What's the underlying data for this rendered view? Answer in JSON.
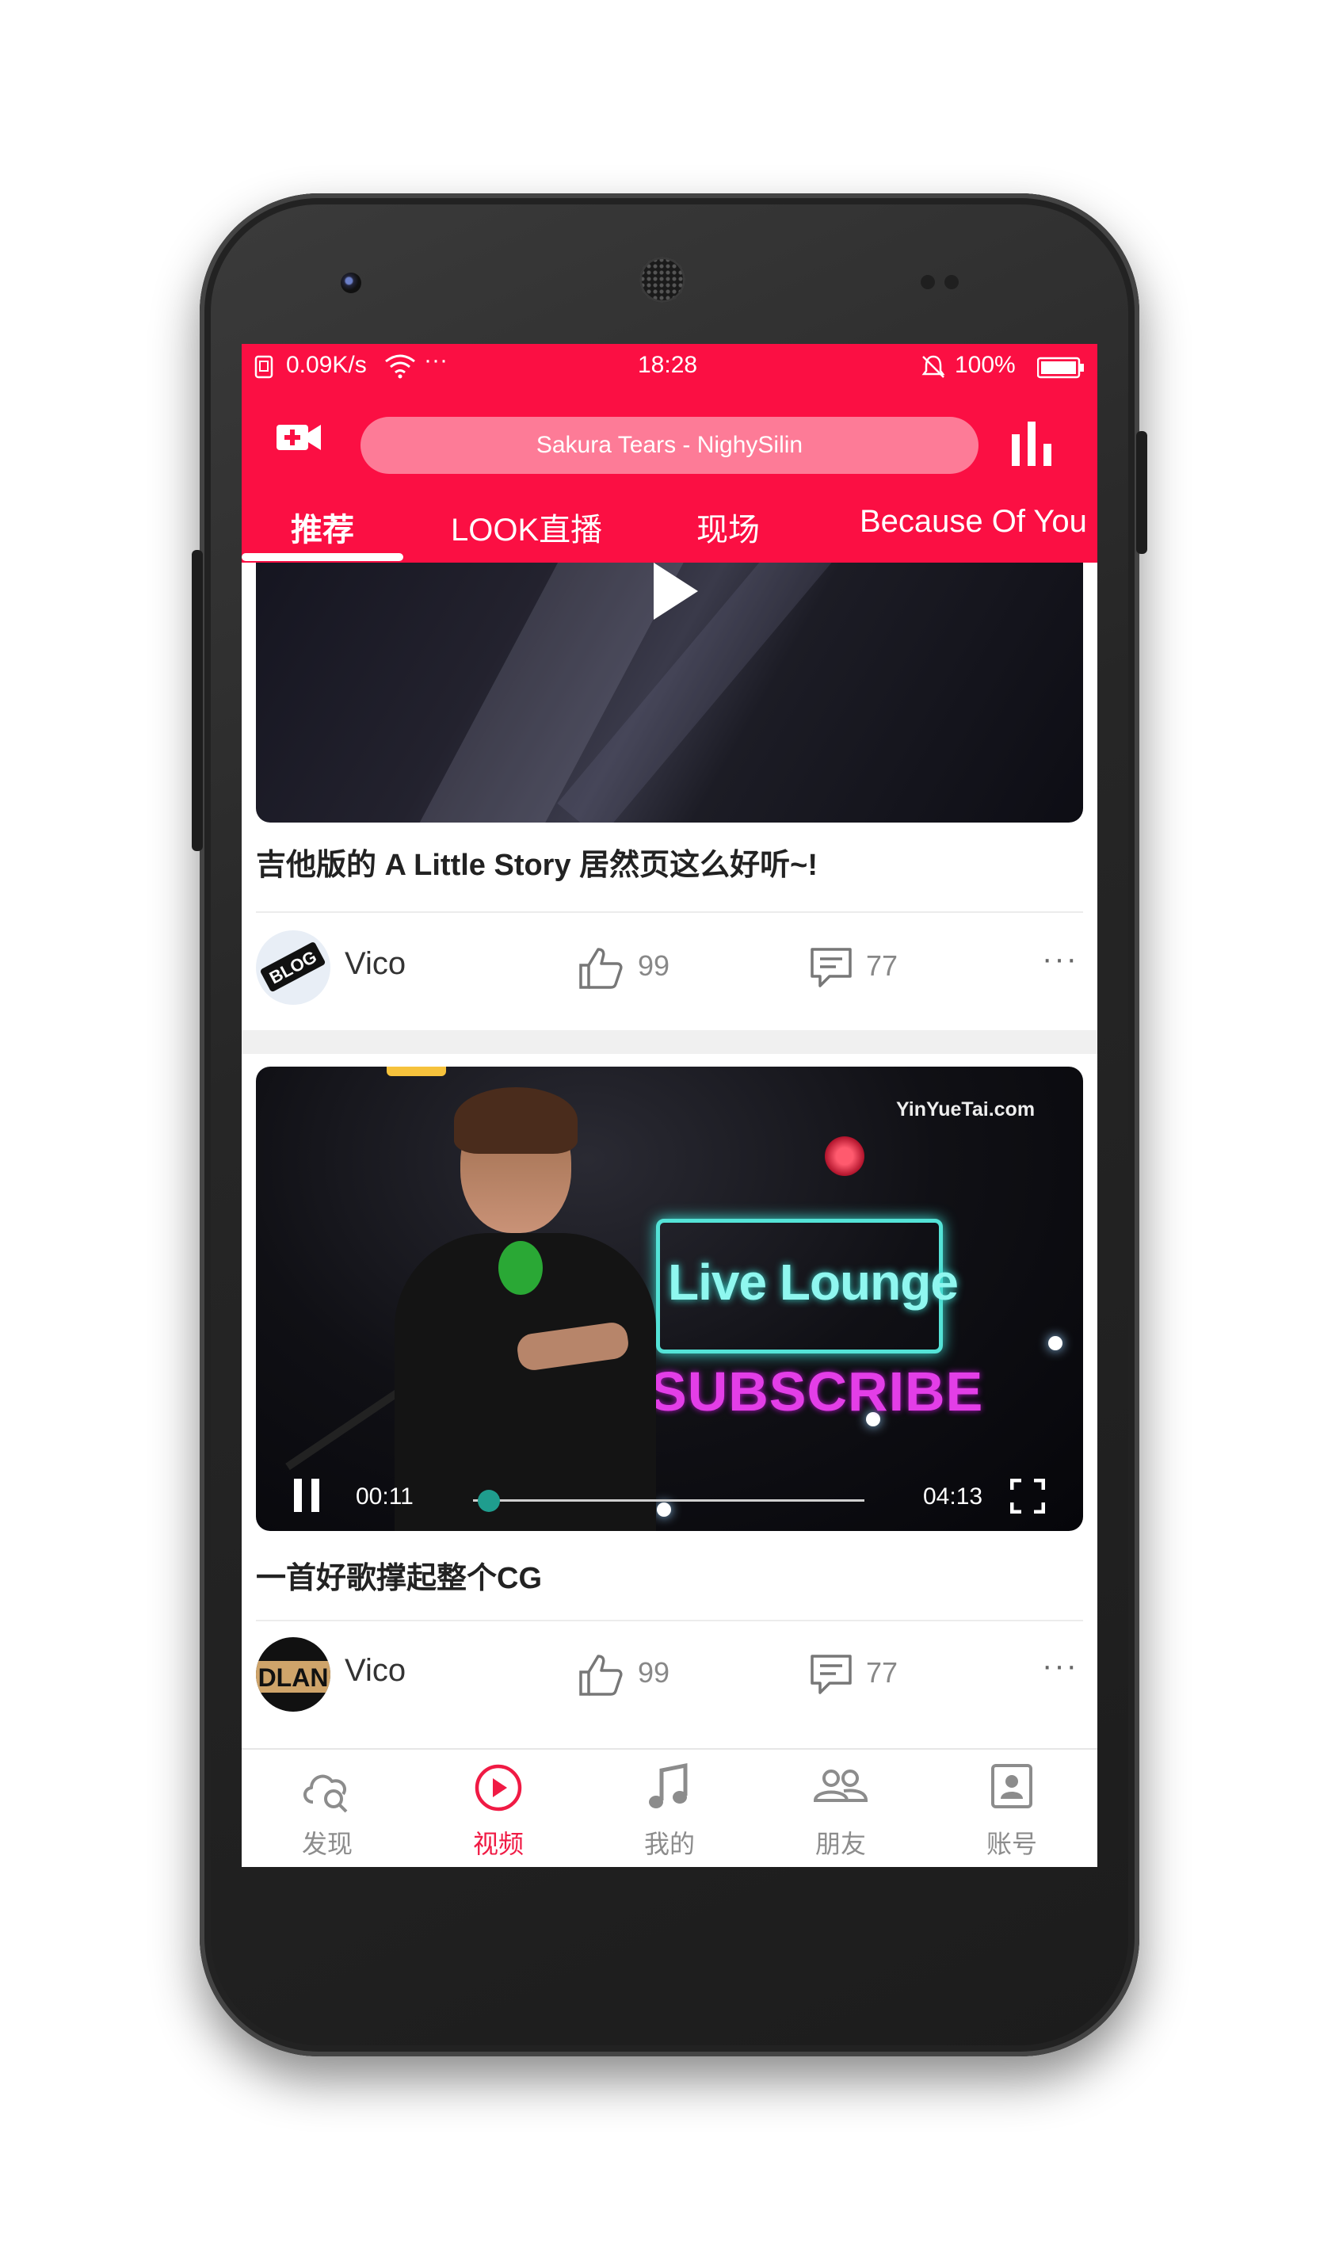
{
  "status_bar": {
    "speed": "0.09K/s",
    "dots": "···",
    "time": "18:28",
    "battery": "100%"
  },
  "header": {
    "search_text": "Sakura Tears - NighySilin"
  },
  "tabs": [
    {
      "label": "推荐",
      "active": true
    },
    {
      "label": "LOOK直播"
    },
    {
      "label": "现场"
    },
    {
      "label": "Because Of You"
    }
  ],
  "feed": [
    {
      "title": "吉他版的 A Little Story 居然页这么好听~!",
      "author": "Vico",
      "likes": "99",
      "comments": "77",
      "more": "···"
    },
    {
      "watermark": "YinYueTai.com",
      "sign_text_1": "Live Lounge",
      "sign_text_2": "SUBSCRIBE",
      "time_current": "00:11",
      "time_total": "04:13",
      "title": "一首好歌撑起整个CG",
      "author": "Vico",
      "likes": "99",
      "comments": "77",
      "more": "···"
    }
  ],
  "bottom_nav": [
    {
      "label": "发现",
      "icon": "cloud-search-icon"
    },
    {
      "label": "视频",
      "icon": "play-circle-icon",
      "active": true
    },
    {
      "label": "我的",
      "icon": "music-note-icon"
    },
    {
      "label": "朋友",
      "icon": "friends-icon"
    },
    {
      "label": "账号",
      "icon": "account-icon"
    }
  ],
  "colors": {
    "accent": "#fb0f43",
    "nav_active": "#f01a44"
  }
}
